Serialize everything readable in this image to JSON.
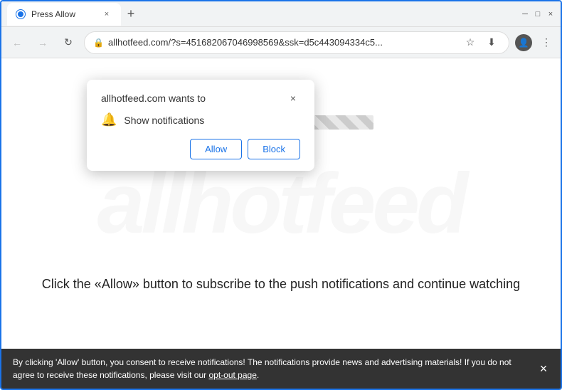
{
  "browser": {
    "tab": {
      "title": "Press Allow",
      "close_label": "×"
    },
    "new_tab_label": "+",
    "window_controls": {
      "minimize": "─",
      "maximize": "□",
      "close": "×"
    },
    "nav": {
      "back": "←",
      "forward": "→",
      "refresh": "↻"
    },
    "address": {
      "url": "allhotfeed.com/?s=451682067046998569&ssk=d5c443094334c5...",
      "lock_icon": "🔒"
    },
    "toolbar_icons": {
      "star": "☆",
      "profile": "👤",
      "menu": "⋮",
      "download": "⬇"
    }
  },
  "notification_dialog": {
    "title": "allhotfeed.com wants to",
    "close_label": "×",
    "show_notifications_label": "Show notifications",
    "bell_icon": "🔔",
    "allow_button": "Allow",
    "block_button": "Block"
  },
  "page": {
    "watermark_text": "allhotfeed",
    "cta_text": "Click the «Allow» button to subscribe to the push notifications and continue watching"
  },
  "bottom_bar": {
    "text": "By clicking 'Allow' button, you consent to receive notifications! The notifications provide news and advertising materials! If you do not agree to receive these notifications, please visit our ",
    "link_text": "opt-out page",
    "close_label": "×"
  }
}
